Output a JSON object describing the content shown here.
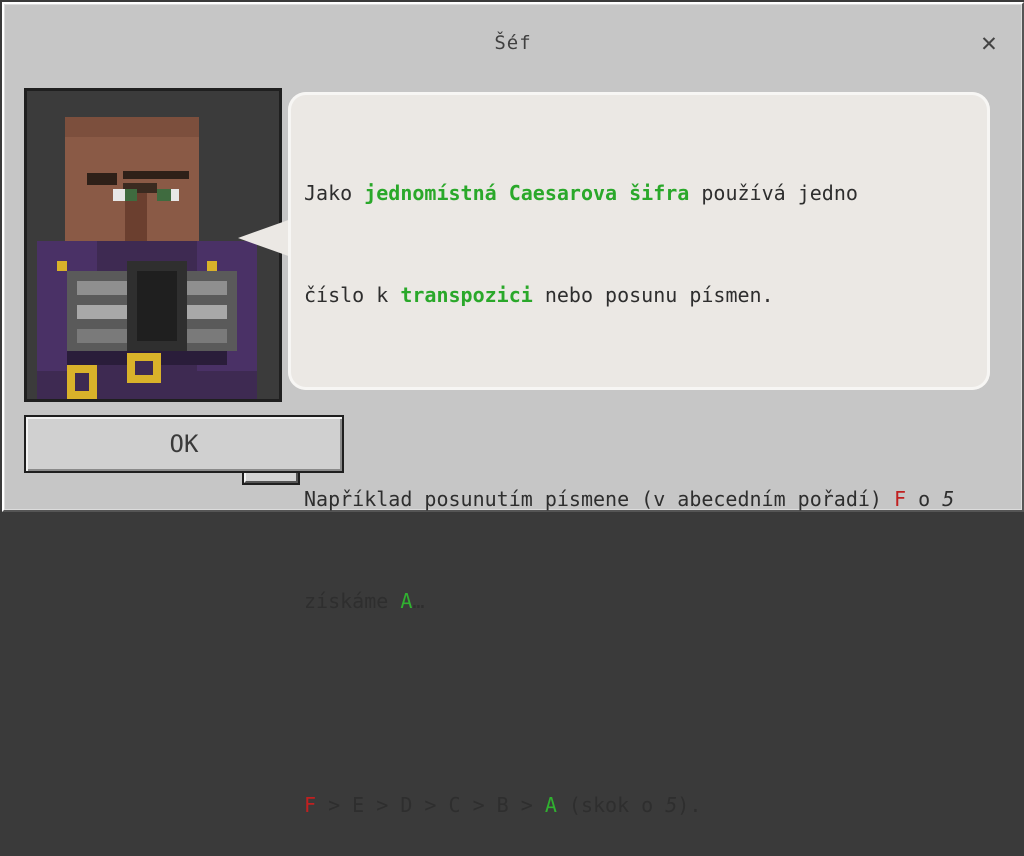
{
  "dialog": {
    "title": "Šéf",
    "close_symbol": "✕"
  },
  "message": {
    "line1": {
      "a": "Jako ",
      "b": "jednomístná Caesarova šifra",
      "c": " používá jedno"
    },
    "line2": {
      "a": "číslo k ",
      "b": "transpozici",
      "c": " nebo posunu písmen."
    },
    "line3": {
      "a": "Například posunutím písmene (v abecedním pořadí) ",
      "b": "F",
      "c": " o ",
      "d": "5"
    },
    "line4": {
      "a": "získáme ",
      "b": "A",
      "c": "…"
    },
    "line5": {
      "f": "F",
      "seq": " > E > D > C > B > ",
      "a": "A",
      "pre": " (skok o ",
      "n": "5",
      "post": ")."
    }
  },
  "ok_button": {
    "label": "OK"
  },
  "icons": {
    "close": "close-icon",
    "audio": "book-speaker-icon",
    "portrait": "villager-portrait"
  },
  "colors": {
    "highlight_green": "#2aa82a",
    "letter_red": "#c02020",
    "letter_green": "#30b030"
  }
}
